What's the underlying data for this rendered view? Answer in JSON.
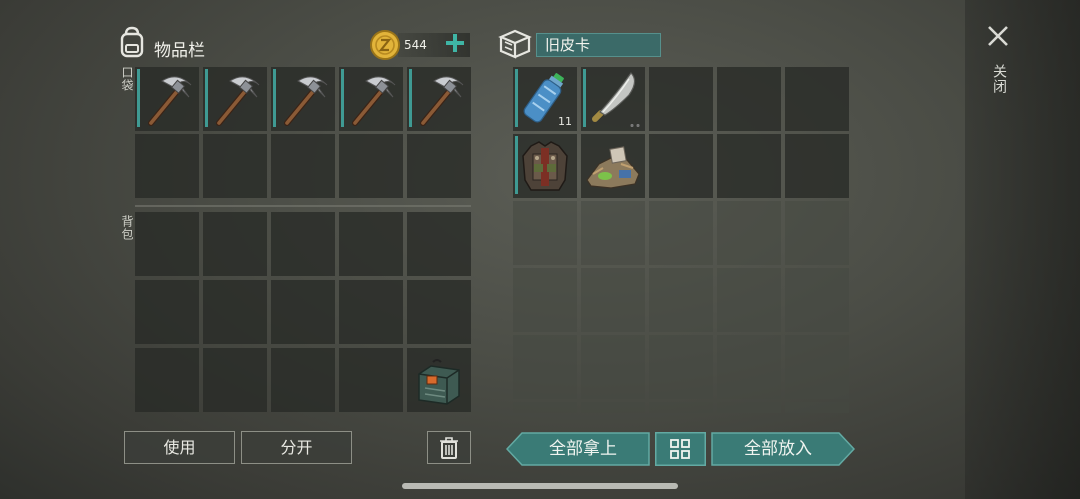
{
  "inventory": {
    "title": "物品栏",
    "coins": "544",
    "pocket_label": "口袋",
    "backpack_label": "背包"
  },
  "container": {
    "name": "旧皮卡",
    "items": [
      {
        "name": "water-bottle",
        "qty": "11"
      },
      {
        "name": "machete",
        "qty": ""
      },
      {
        "name": "armor-jacket",
        "qty": ""
      },
      {
        "name": "scrap-pile",
        "qty": ""
      }
    ]
  },
  "actions": {
    "use": "使用",
    "split": "分开",
    "take_all": "全部拿上",
    "put_all": "全部放入"
  },
  "close": {
    "label": "关闭"
  },
  "colors": {
    "accent": "#3fb5a5",
    "panel_teal": "#3b6a68"
  }
}
